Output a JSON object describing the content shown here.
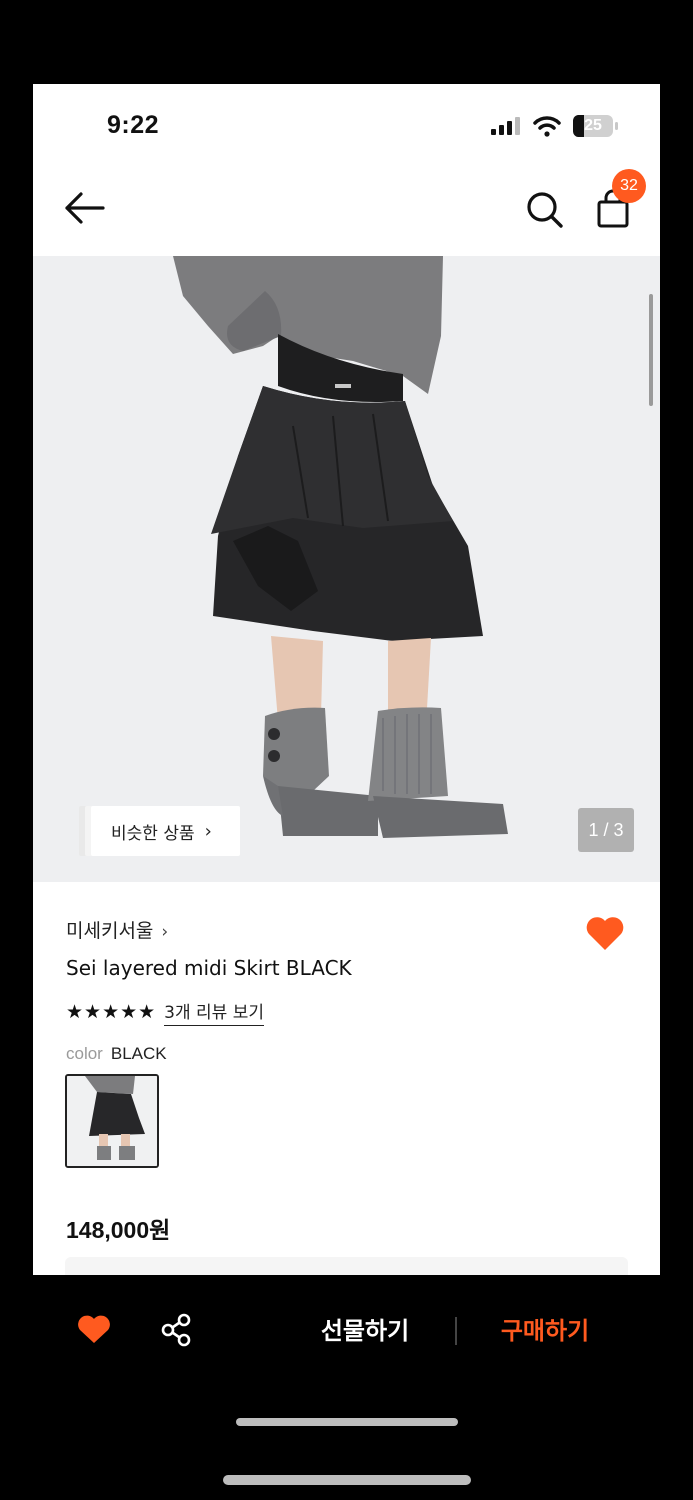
{
  "status_bar": {
    "time": "9:22",
    "battery": "25"
  },
  "nav": {
    "cart_count": "32"
  },
  "gallery": {
    "similar_label": "비슷한 상품",
    "counter": "1 / 3"
  },
  "product": {
    "brand": "미세키서울",
    "name": "Sei layered midi Skirt BLACK",
    "rating_stars": "★★★★★",
    "review_link": "3개 리뷰 보기",
    "color_label": "color",
    "color_value": "BLACK",
    "price": "148,000원",
    "liked": true
  },
  "bottom_bar": {
    "gift_label": "선물하기",
    "buy_label": "구매하기"
  },
  "colors": {
    "accent": "#ff5a1f",
    "badge": "#ff5a1f"
  },
  "icons": [
    "signal-icon",
    "wifi-icon",
    "battery-icon",
    "back-arrow-icon",
    "search-icon",
    "shopping-bag-icon",
    "heart-icon",
    "share-icon",
    "chevron-right-icon"
  ]
}
